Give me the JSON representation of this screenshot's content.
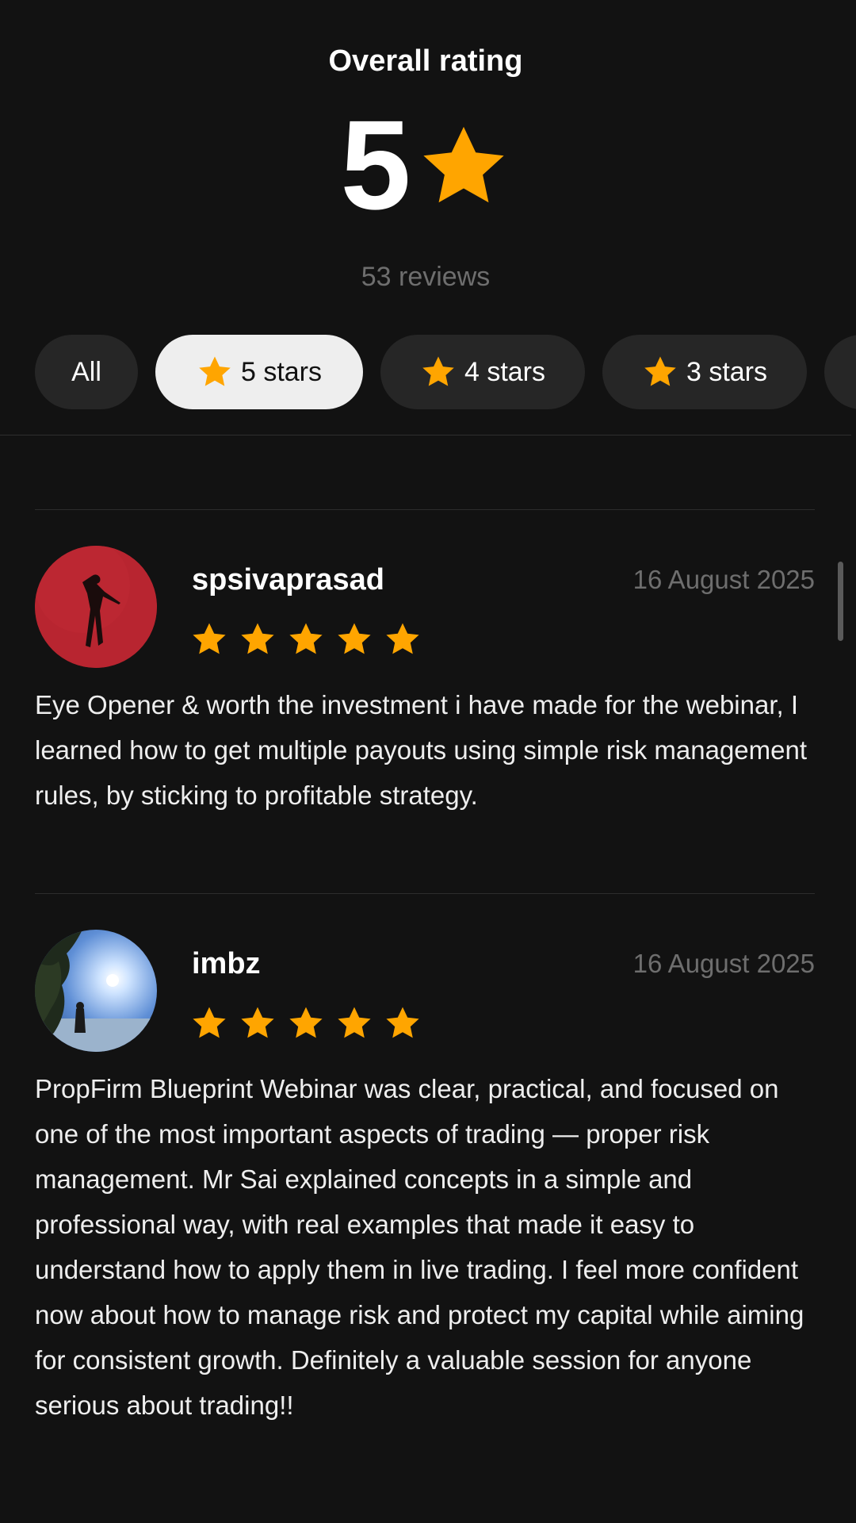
{
  "header": {
    "title": "Overall rating",
    "rating_value": "5",
    "reviews_count": "53 reviews"
  },
  "filters": [
    {
      "label": "All",
      "selected": false
    },
    {
      "label": "5 stars",
      "selected": true
    },
    {
      "label": "4 stars",
      "selected": false
    },
    {
      "label": "3 stars",
      "selected": false
    }
  ],
  "reviews": [
    {
      "username": "spsivaprasad",
      "date": "16 August 2025",
      "rating": 5,
      "text": "Eye Opener & worth the investment i have made for the webinar, I learned how to get multiple payouts using simple risk management rules, by sticking to profitable strategy."
    },
    {
      "username": "imbz",
      "date": "16 August 2025",
      "rating": 5,
      "text": "PropFirm Blueprint Webinar was clear, practical, and focused on one of the most important aspects of trading — proper risk management. Mr Sai explained concepts in a simple and professional way, with real examples that made it easy to understand how to apply them in live trading. I feel more confident now about how to manage risk and protect my capital while aiming for consistent growth. Definitely a valuable session for anyone serious about trading!!"
    }
  ],
  "colors": {
    "background": "#121212",
    "star": "#FFA500",
    "chip": "#262626",
    "chip_selected": "#EEEEEE",
    "muted_text": "#6E6E6E"
  },
  "icons": {
    "star": "star-icon",
    "avatar": "avatar"
  }
}
